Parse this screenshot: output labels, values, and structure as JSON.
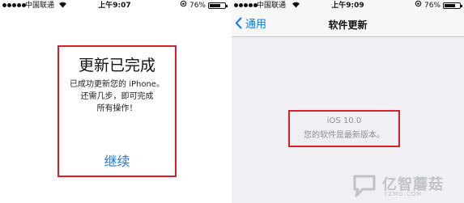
{
  "left_screen": {
    "status_bar": {
      "carrier": "中国联通",
      "time": "上午9:07",
      "battery": "76%",
      "battery_level": 0.76
    },
    "alert": {
      "title": "更新已完成",
      "line1": "已成功更新您的 iPhone。",
      "line2": "还需几步，即可完成",
      "line3": "所有操作！",
      "continue_label": "继续"
    }
  },
  "right_screen": {
    "status_bar": {
      "carrier": "中国联通",
      "time": "上午9:09",
      "battery": "76%",
      "battery_level": 0.76
    },
    "navbar": {
      "back_label": "通用",
      "title": "软件更新"
    },
    "update_info": {
      "version": "iOS 10.0",
      "message": "您的软件是最新版本。"
    }
  },
  "colors": {
    "accent": "#1479e6",
    "highlight_box": "#d9202a"
  },
  "watermark": {
    "text": "亿智蘑菇",
    "sub": "YZMG.COM"
  }
}
